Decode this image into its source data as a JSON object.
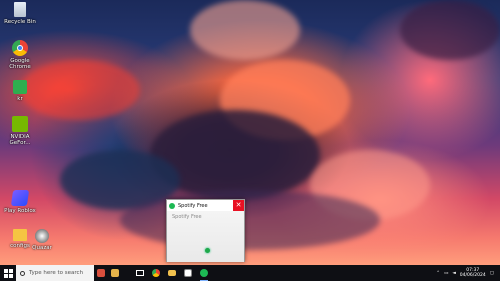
{
  "desktop": {
    "icons": [
      {
        "label": "Recycle Bin",
        "icon": "recycle-bin-icon"
      },
      {
        "label": "Google Chrome",
        "icon": "chrome-icon"
      },
      {
        "label": "kr",
        "icon": "app-shortcut-icon"
      },
      {
        "label": "NVIDIA GeFor...",
        "icon": "nvidia-icon"
      },
      {
        "label": "Play Roblox",
        "icon": "roblox-icon"
      },
      {
        "label": "configs",
        "icon": "folder-icon"
      },
      {
        "label": "Quazar",
        "icon": "quazar-icon"
      }
    ]
  },
  "window": {
    "title": "Spotify Free",
    "close_glyph": "✕",
    "placeholder": "Spotify Free"
  },
  "taskbar": {
    "search_placeholder": "Type here to search",
    "pinned": [
      "task-view-icon",
      "chrome-icon",
      "file-explorer-icon",
      "store-icon",
      "spotify-icon"
    ],
    "time": "07:37",
    "date": "04/06/2024"
  },
  "colors": {
    "accent_green": "#1db954",
    "close_red": "#e81123",
    "taskbar_bg": "#0e0f14"
  }
}
